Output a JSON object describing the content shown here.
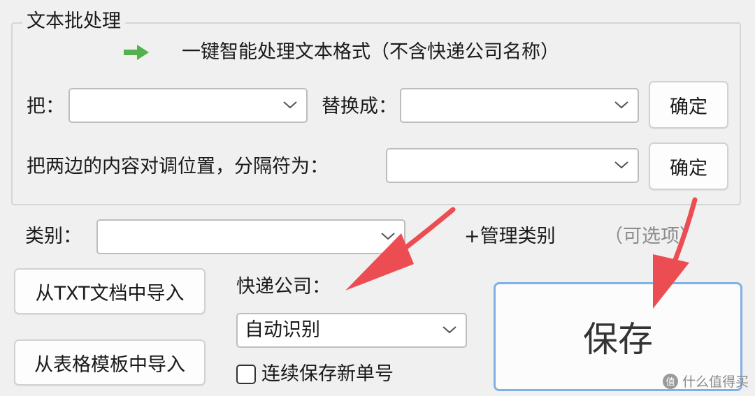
{
  "group": {
    "title": "文本批处理",
    "smart_process_label": "一键智能处理文本格式（不含快递公司名称）"
  },
  "replace": {
    "from_label": "把：",
    "from_value": "",
    "to_label": "替换成：",
    "to_value": "",
    "confirm_label": "确定"
  },
  "swap": {
    "label": "把两边的内容对调位置，分隔符为：",
    "separator_value": "",
    "confirm_label": "确定"
  },
  "category": {
    "label": "类别：",
    "value": "",
    "manage_label": "+管理类别",
    "optional_label": "（可选项）"
  },
  "import": {
    "txt_label": "从TXT文档中导入",
    "table_label": "从表格模板中导入"
  },
  "courier": {
    "label": "快递公司：",
    "value": "自动识别"
  },
  "continuous_save": {
    "label": "连续保存新单号",
    "checked": false
  },
  "save_label": "保存",
  "watermark": {
    "logo": "值",
    "text": "什么值得买"
  },
  "colors": {
    "arrow_red": "#ec4d52",
    "green_arrow": "#53b24f",
    "save_border": "#7fb2e3"
  }
}
